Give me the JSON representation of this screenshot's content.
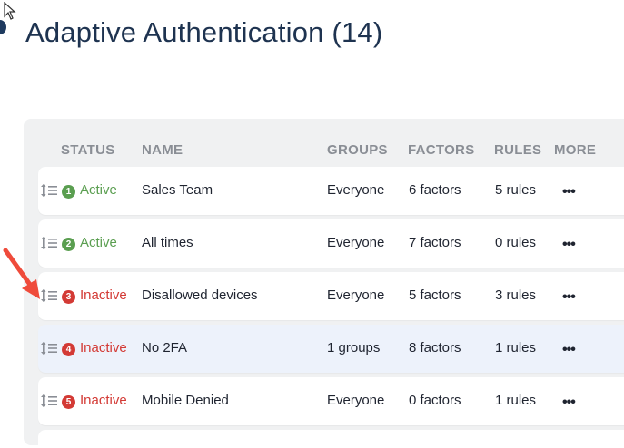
{
  "page": {
    "title": "Adaptive Authentication (14)"
  },
  "colors": {
    "active": "#5a9e50",
    "inactive": "#d33a35",
    "arrow": "#ef4b3b"
  },
  "table": {
    "headers": {
      "status": "STATUS",
      "name": "NAME",
      "groups": "GROUPS",
      "factors": "FACTORS",
      "rules": "RULES",
      "more": "MORE"
    },
    "rows": [
      {
        "num": "1",
        "status": "Active",
        "active": true,
        "name": "Sales Team",
        "groups": "Everyone",
        "factors": "6 factors",
        "rules": "5 rules",
        "more": "•••",
        "highlight": false
      },
      {
        "num": "2",
        "status": "Active",
        "active": true,
        "name": "All times",
        "groups": "Everyone",
        "factors": "7 factors",
        "rules": "0 rules",
        "more": "•••",
        "highlight": false
      },
      {
        "num": "3",
        "status": "Inactive",
        "active": false,
        "name": "Disallowed devices",
        "groups": "Everyone",
        "factors": "5 factors",
        "rules": "3 rules",
        "more": "•••",
        "highlight": false
      },
      {
        "num": "4",
        "status": "Inactive",
        "active": false,
        "name": "No 2FA",
        "groups": "1 groups",
        "factors": "8 factors",
        "rules": "1 rules",
        "more": "•••",
        "highlight": true
      },
      {
        "num": "5",
        "status": "Inactive",
        "active": false,
        "name": "Mobile Denied",
        "groups": "Everyone",
        "factors": "0 factors",
        "rules": "1 rules",
        "more": "•••",
        "highlight": false
      }
    ]
  }
}
